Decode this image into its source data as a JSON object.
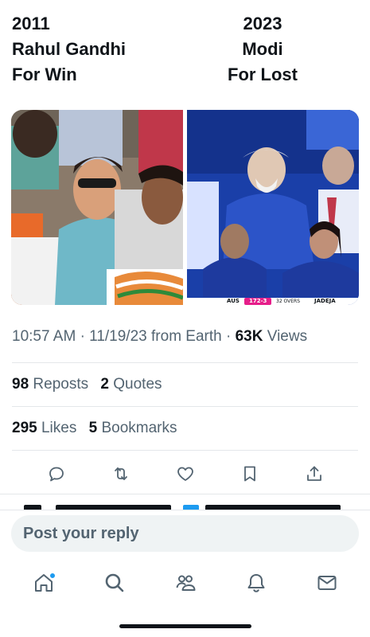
{
  "image_captions": {
    "left": {
      "line1": "2011",
      "line2": "Rahul Gandhi",
      "line3": "For Win"
    },
    "right": {
      "line1": "2023",
      "line2": "Modi",
      "line3": "For Lost"
    }
  },
  "media": {
    "right_scoreboard": {
      "team": "AUS",
      "score": "172-3",
      "overs": "32 OVERS",
      "player": "JADEJA"
    }
  },
  "post_meta": {
    "time": "10:57 AM",
    "date": "11/19/23",
    "source": "from Earth",
    "views_count": "63K",
    "views_label": "Views"
  },
  "stats": {
    "reposts_count": "98",
    "reposts_label": "Reposts",
    "quotes_count": "2",
    "quotes_label": "Quotes",
    "likes_count": "295",
    "likes_label": "Likes",
    "bookmarks_count": "5",
    "bookmarks_label": "Bookmarks"
  },
  "actions": [
    "reply-icon",
    "repost-icon",
    "like-icon",
    "bookmark-icon",
    "share-icon"
  ],
  "reply": {
    "placeholder": "Post your reply"
  },
  "tabbar": [
    "home-icon",
    "search-icon",
    "communities-icon",
    "notifications-icon",
    "messages-icon"
  ],
  "colors": {
    "accent": "#1d9bf0",
    "text": "#0f1419",
    "muted": "#536471",
    "divider": "#e4e7ea"
  }
}
